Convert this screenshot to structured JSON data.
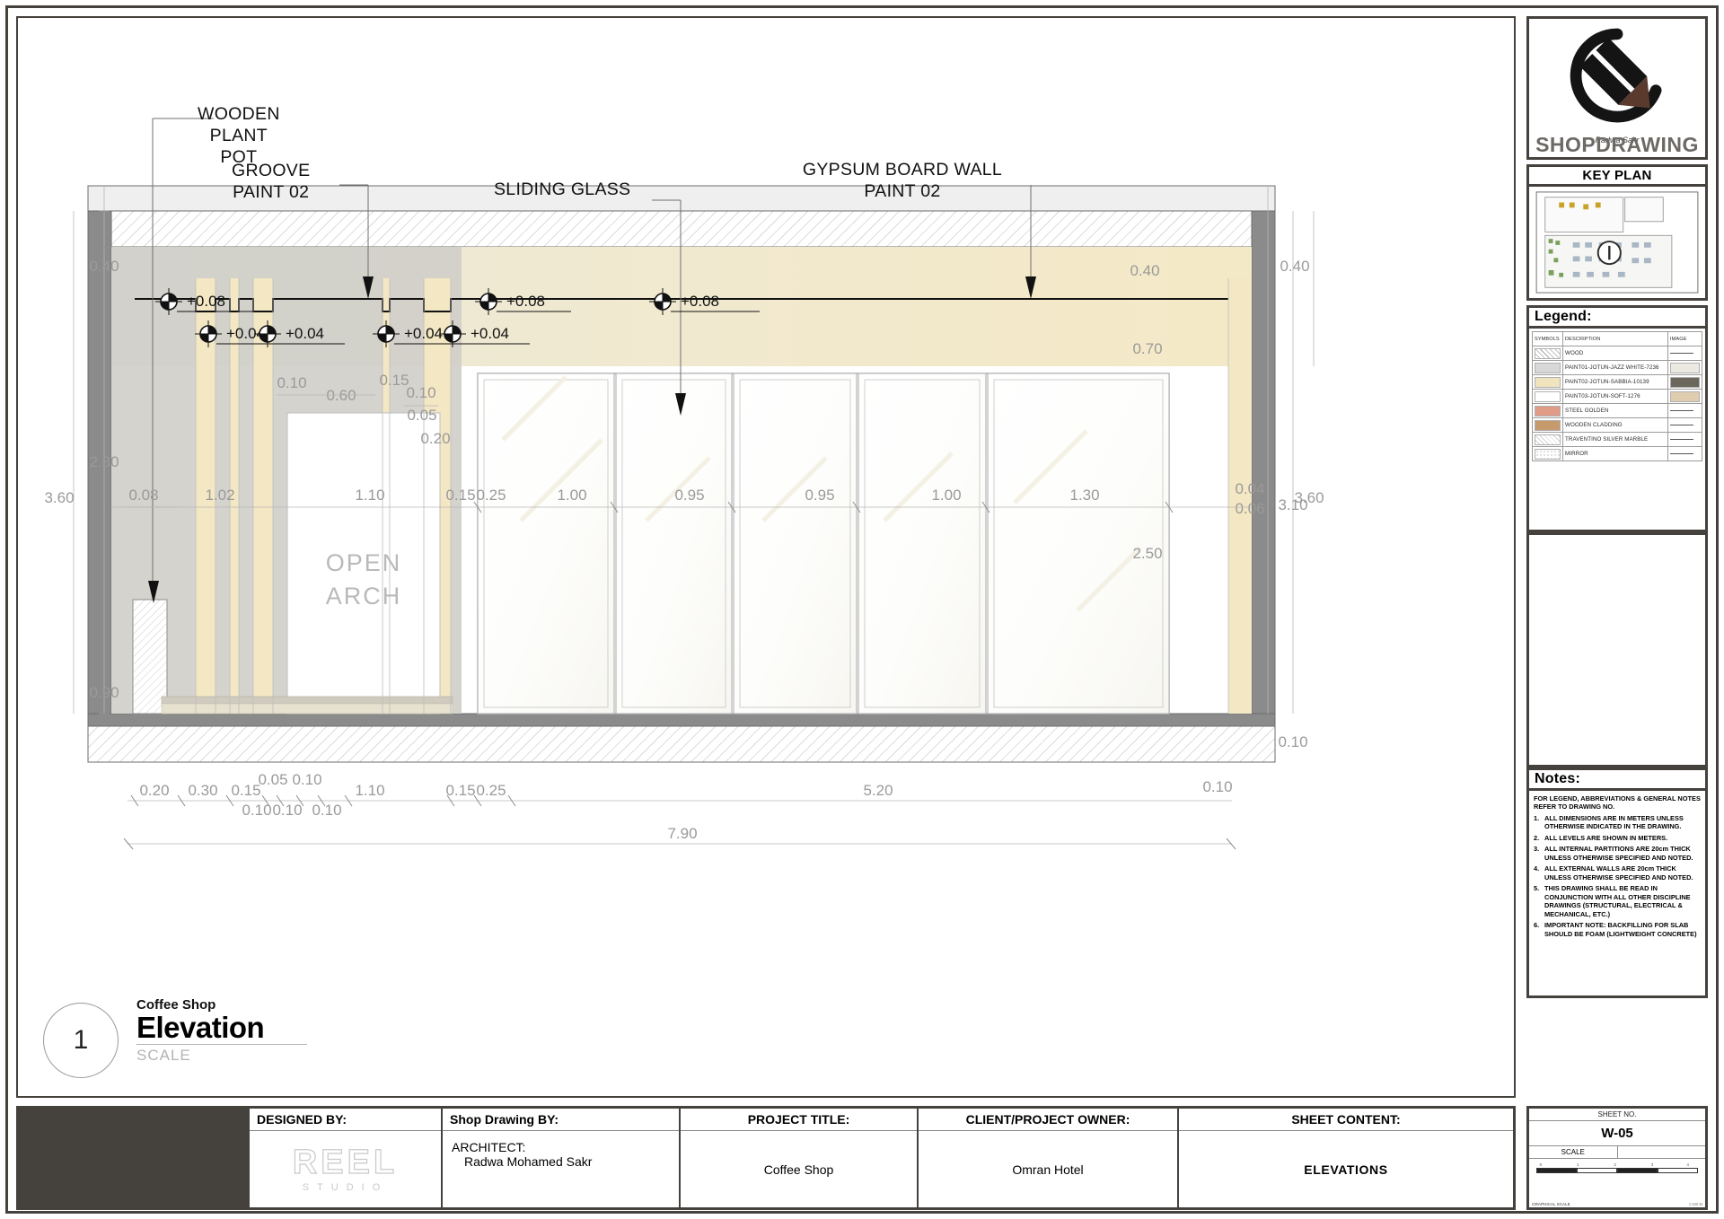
{
  "titleblock": {
    "designed_by_label": "DESIGNED BY:",
    "designer_logo_main": "REEL",
    "designer_logo_sub": "STUDIO",
    "shop_drawing_by_label": "Shop Drawing BY:",
    "architect_label": "ARCHITECT:",
    "architect_name": "Radwa Mohamed Sakr",
    "project_title_label": "PROJECT TITLE:",
    "project_title": "Coffee Shop",
    "client_label": "CLIENT/PROJECT OWNER:",
    "client": "Omran Hotel",
    "sheet_content_label": "SHEET CONTENT:",
    "sheet_content": "ELEVATIONS",
    "sheet_no_label": "SHEET NO.",
    "sheet_no": "W-05",
    "scale_label": "SCALE",
    "scale_value": "",
    "graphical_scale_label": "GRAPHICAL SCALE",
    "graphical_scale_note": "1:100 M",
    "scale_ticks": [
      "0",
      "1",
      "2",
      "3",
      "4"
    ]
  },
  "brand": {
    "logo_signature": "Radwa Sakr",
    "logo_word": "SHOPDRAWING",
    "key_plan_label": "KEY PLAN"
  },
  "legend": {
    "heading": "Legend:",
    "columns": [
      "SYMBOLS",
      "DESCRIPTION",
      "IMAGE"
    ],
    "rows": [
      {
        "description": "WOOD",
        "swatch": "hatch-wood",
        "image": "line"
      },
      {
        "description": "PAINT01-JOTUN-JAZZ WHITE-7236",
        "swatch": "#d8d8d8",
        "image": "#ece9e0"
      },
      {
        "description": "PAINT02-JOTUN-SABBIA-10139",
        "swatch": "#f0e4bf",
        "image": "#6b675c"
      },
      {
        "description": "PAINT03-JOTUN-SOFT-1276",
        "swatch": "#ffffff",
        "image": "#e0cdb0"
      },
      {
        "description": "STEEL GOLDEN",
        "swatch": "#e09b87",
        "image": "line"
      },
      {
        "description": "WOODEN CLADDING",
        "swatch": "#c79a6e",
        "image": "line"
      },
      {
        "description": "TRAVENTINO SILVER MARBLE",
        "swatch": "hatch-marble",
        "image": "line"
      },
      {
        "description": "MIRROR",
        "swatch": "dots-mirror",
        "image": "line"
      }
    ]
  },
  "notes": {
    "heading": "Notes:",
    "intro": "FOR LEGEND, ABBREVIATIONS & GENERAL NOTES REFER TO DRAWING NO.",
    "items": [
      "ALL DIMENSIONS ARE IN METERS UNLESS OTHERWISE INDICATED IN THE DRAWING.",
      "ALL LEVELS ARE SHOWN IN METERS.",
      "ALL INTERNAL PARTITIONS ARE 20cm THICK UNLESS OTHERWISE SPECIFIED AND NOTED.",
      "ALL EXTERNAL WALLS ARE 20cm THICK UNLESS OTHERWISE SPECIFIED AND NOTED.",
      "THIS DRAWING SHALL BE READ IN CONJUNCTION WITH ALL OTHER DISCIPLINE DRAWINGS (STRUCTURAL, ELECTRICAL & MECHANICAL, ETC.)",
      "IMPORTANT NOTE: BACKFILLING FOR SLAB SHOULD BE FOAM (LIGHTWEIGHT CONCRETE)"
    ]
  },
  "drawing": {
    "view_number": "1",
    "view_project": "Coffee Shop",
    "view_title": "Elevation",
    "view_scale_label": "SCALE",
    "callouts": [
      {
        "id": "wooden-plant-pot",
        "text": "WOODEN\nPLANT\nPOT"
      },
      {
        "id": "groove-paint-02",
        "text": "GROOVE\nPAINT 02"
      },
      {
        "id": "sliding-glass",
        "text": "SLIDING GLASS"
      },
      {
        "id": "gypsum-board-wall",
        "text": "GYPSUM BOARD WALL\nPAINT 02"
      }
    ],
    "open_arch_label": "OPEN\nARCH",
    "levels": [
      "+0.08",
      "+0.04",
      "+0.08",
      "+0.04",
      "+0.04",
      "+0.08",
      "+0.04"
    ],
    "vertical_dims_left_outer": [
      "0.40",
      "3.60"
    ],
    "vertical_dims_left_inner": [
      "0.40",
      "2.30",
      "0.08",
      "0.90"
    ],
    "vertical_dims_right_outer": [
      "0.40",
      "3.60"
    ],
    "vertical_dims_right_inner": [
      "0.40",
      "0.70",
      "3.10",
      "0.04",
      "0.06",
      "2.50",
      "0.10"
    ],
    "inner_detail_dims": [
      "0.10",
      "0.60",
      "0.15",
      "0.10",
      "0.05",
      "0.20"
    ],
    "mid_chain": [
      "0.08",
      "1.02",
      "1.10",
      "0.15",
      "0.25",
      "1.00",
      "0.95",
      "0.95",
      "1.00",
      "1.30"
    ],
    "bottom_chain_upper": [
      "0.20",
      "0.30",
      "0.15",
      "0.05",
      "0.10"
    ],
    "bottom_chain_lower": [
      "0.10",
      "0.10",
      "0.10"
    ],
    "bottom_chain_main": [
      "1.10",
      "0.15",
      "0.25",
      "5.20",
      "0.10"
    ],
    "overall_dim": "7.90"
  },
  "colors": {
    "frame": "#45413d",
    "paint02": "#f3e7c4",
    "paint01": "#d9d9d4",
    "wall_gray": "#8b8b8b",
    "dim_text": "#8e8e8e"
  }
}
